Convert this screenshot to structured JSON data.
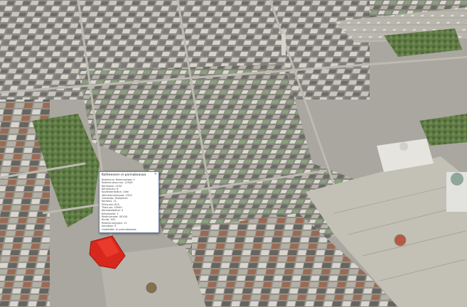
{
  "map": {
    "view": "3D oblique city model",
    "colors": {
      "ground": "#a9a79f",
      "plaza": "#c3c0b6",
      "park": "#5f7a45",
      "roof_dark": "#6b6a66",
      "roof_light": "#d8d6d0",
      "roof_green": "#8aa07e",
      "roof_brick": "#9a6a52",
      "selected_building": "#d8271c"
    }
  },
  "popup": {
    "title": "Kohteeseen ei parinakeavaa",
    "close_icon": "close-icon",
    "rows": [
      "Rakennus: Rakennetaan 1",
      "Rakennustunnus: 12345",
      "Kerrosala: 1234",
      "Kerrosluku: 6",
      "Kayttotarkoitus: Liike",
      "Valmistumisvuosi: 1920",
      "Omistaja: Yksityinen",
      "Korkeus: 21",
      "Pinta-ala: 815",
      "Tilavuus: 15000",
      "Kerrostaloalue: 2",
      "Katuosoite: 1",
      "Postinumero: 00100",
      "Kunta: 091",
      "Rakennustyyppi: 11",
      "Asuntoja: 0",
      "Lisatiedot: ei parinakeavaa"
    ]
  }
}
